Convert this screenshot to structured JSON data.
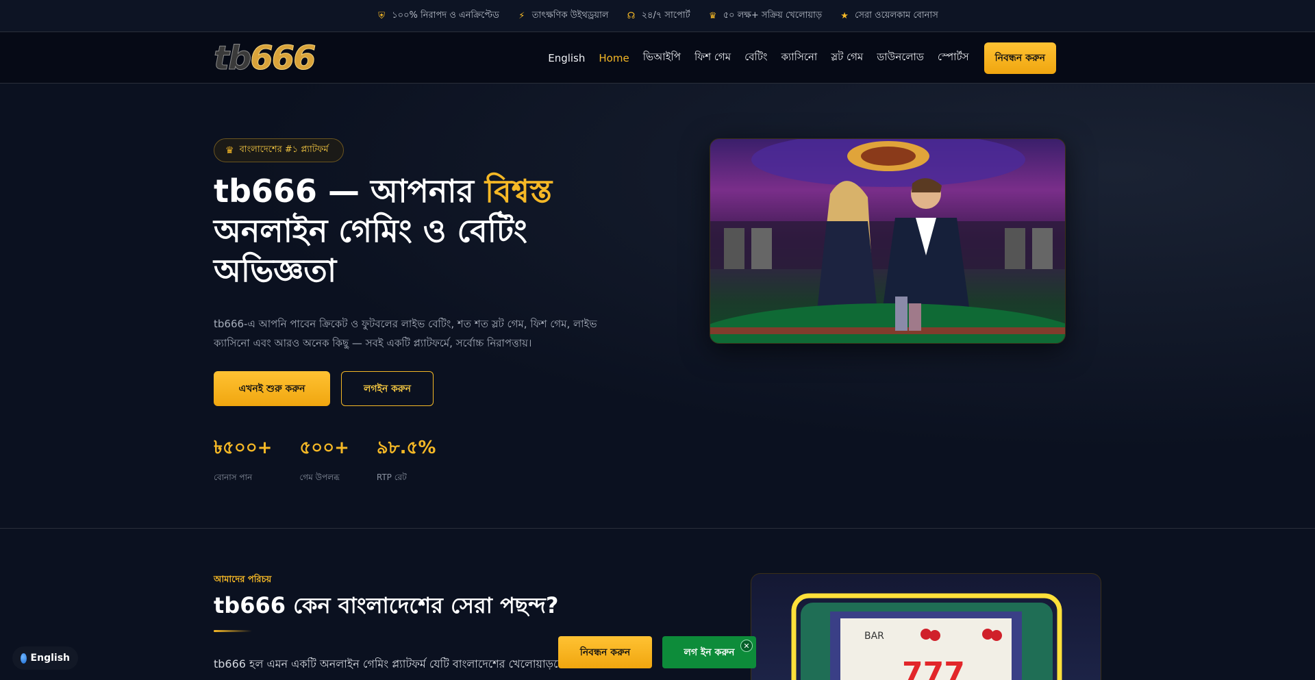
{
  "topbar": {
    "items": [
      {
        "icon": "shield-icon",
        "text": "১০০% নিরাপদ ও এনক্রিপ্টেড"
      },
      {
        "icon": "bolt-icon",
        "text": "তাৎক্ষণিক উইথড্রয়াল"
      },
      {
        "icon": "headset-icon",
        "text": "২৪/৭ সাপোর্ট"
      },
      {
        "icon": "trophy-icon",
        "text": "৫০ লক্ষ+ সক্রিয় খেলোয়াড়"
      },
      {
        "icon": "star-icon",
        "text": "সেরা ওয়েলকাম বোনাস"
      }
    ]
  },
  "nav": {
    "logo_tb": "tb",
    "logo_num": "666",
    "links": [
      "English",
      "Home",
      "ভিআইপি",
      "ফিশ গেম",
      "বেটিং",
      "ক্যাসিনো",
      "স্লট গেম",
      "ডাউনলোড",
      "স্পোর্টস"
    ],
    "active": "Home",
    "register": "নিবন্ধন করুন"
  },
  "hero": {
    "badge": "বাংলাদেশের #১ প্ল্যাটফর্ম",
    "title_pre": "tb666 — আপনার ",
    "title_highlight": "বিশ্বস্ত",
    "title_post": " অনলাইন গেমিং ও বেটিং অভিজ্ঞতা",
    "description": "tb666-এ আপনি পাবেন ক্রিকেট ও ফুটবলের লাইভ বেটিং, শত শত স্লট গেম, ফিশ গেম, লাইভ ক্যাসিনো এবং আরও অনেক কিছু — সবই একটি প্ল্যাটফর্মে, সর্বোচ্চ নিরাপত্তায়।",
    "cta_primary": "এখনই শুরু করুন",
    "cta_secondary": "লগইন করুন",
    "stats": [
      {
        "value": "৳৫০০+",
        "label": "বোনাস পান"
      },
      {
        "value": "৫০০+",
        "label": "গেম উপলব্ধ"
      },
      {
        "value": "৯৮.৫%",
        "label": "RTP রেট"
      }
    ]
  },
  "about": {
    "eyebrow": "আমাদের পরিচয়",
    "title": "tb666 কেন বাংলাদেশের সেরা পছন্দ?",
    "text": "tb666 হল এমন একটি অনলাইন গেমিং প্ল্যাটফর্ম যেটি বাংলাদেশের খেলোয়াড়দের কথা"
  },
  "floating": {
    "language": "English",
    "register": "নিবন্ধন করুন",
    "login": "লগ ইন করুন",
    "close": "✕"
  }
}
